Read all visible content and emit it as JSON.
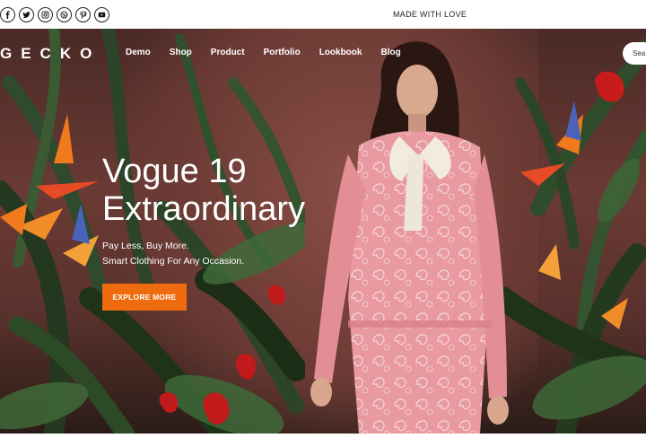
{
  "topbar": {
    "social": [
      {
        "icon": "facebook-icon"
      },
      {
        "icon": "twitter-icon"
      },
      {
        "icon": "instagram-icon"
      },
      {
        "icon": "dribbble-icon"
      },
      {
        "icon": "pinterest-icon"
      },
      {
        "icon": "youtube-icon"
      }
    ],
    "message": "MADE WITH LOVE"
  },
  "header": {
    "logo": "GECKO",
    "nav": [
      "Demo",
      "Shop",
      "Product",
      "Portfolio",
      "Lookbook",
      "Blog"
    ],
    "search_placeholder": "Sea"
  },
  "hero": {
    "title_line1": "Vogue 19",
    "title_line2": "Extraordinary",
    "subtitle_line1": "Pay Less, Buy More.",
    "subtitle_line2": "Smart Clothing For Any Occasion.",
    "cta_label": "EXPLORE MORE"
  },
  "colors": {
    "accent": "#ee6c0e",
    "text_on_hero": "#ffffff"
  }
}
